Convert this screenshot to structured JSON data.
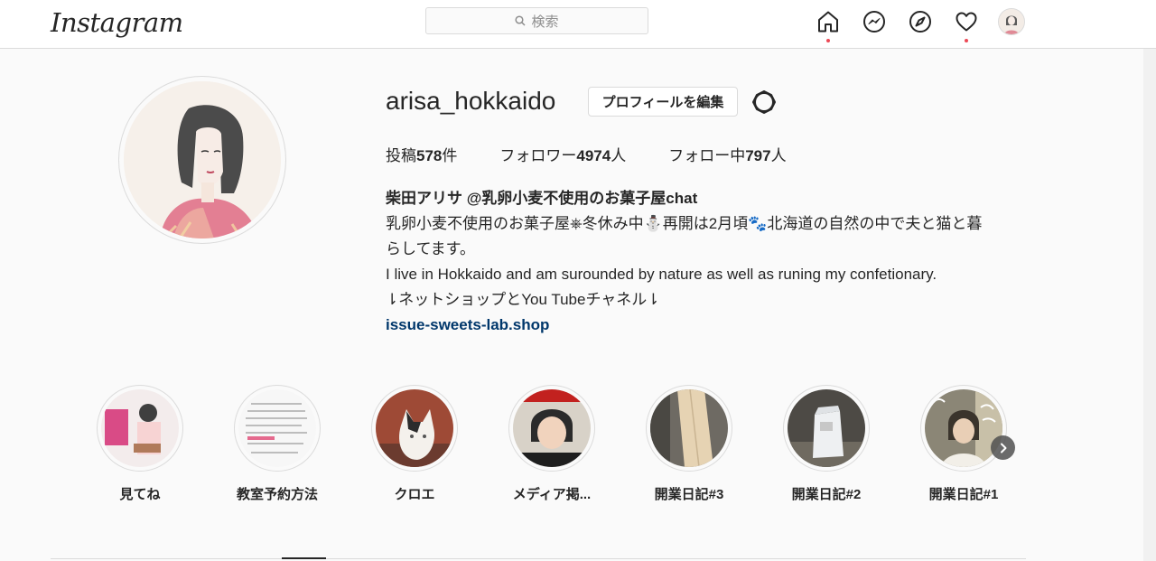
{
  "header": {
    "logo": "Instagram",
    "search_placeholder": "検索",
    "icons": [
      "home-icon",
      "messenger-icon",
      "explore-icon",
      "activity-heart-icon",
      "profile-avatar"
    ],
    "notification_color": "#ed4956"
  },
  "profile": {
    "username": "arisa_hokkaido",
    "edit_button": "プロフィールを編集",
    "stats": {
      "posts_prefix": "投稿",
      "posts_count": "578",
      "posts_suffix": "件",
      "followers_prefix": "フォロワー",
      "followers_count": "4974",
      "followers_suffix": "人",
      "following_prefix": "フォロー中",
      "following_count": "797",
      "following_suffix": "人"
    },
    "bio": {
      "name": "柴田アリサ @乳卵小麦不使用のお菓子屋chat",
      "line1": "乳卵小麦不使用のお菓子屋⎈冬休み中⛄再開は2月頃🐾北海道の自然の中で夫と猫と暮",
      "line2": "らしてます。",
      "line3": "I live in Hokkaido and am surounded by nature as well as runing my confetionary.",
      "line4": "⇂ネットショップとYou Tubeチャネル⇂",
      "link": "issue-sweets-lab.shop"
    }
  },
  "highlights": [
    {
      "label": "見てね"
    },
    {
      "label": "教室予約方法"
    },
    {
      "label": "クロエ"
    },
    {
      "label": "メディア掲..."
    },
    {
      "label": "開業日記#3"
    },
    {
      "label": "開業日記#2"
    },
    {
      "label": "開業日記#1"
    }
  ],
  "colors": {
    "link": "#00376b",
    "text": "#262626",
    "border": "#dbdbdb",
    "background": "#fafafa"
  }
}
